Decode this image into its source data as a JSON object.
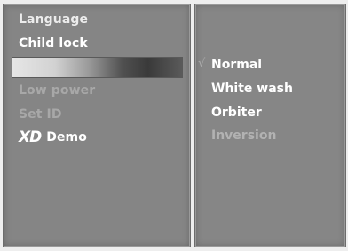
{
  "main_menu": {
    "items": [
      {
        "label": "Language"
      },
      {
        "label": "Child lock"
      },
      {
        "label": ""
      },
      {
        "label": "Low power"
      },
      {
        "label": "Set ID"
      },
      {
        "logo": "XD",
        "label": "Demo"
      }
    ],
    "selected_index": 2
  },
  "submenu": {
    "check_mark": "√",
    "items": [
      {
        "label": "Normal",
        "checked": true
      },
      {
        "label": "White wash"
      },
      {
        "label": "Orbiter"
      },
      {
        "label": "Inversion"
      }
    ]
  },
  "colors": {
    "panel": "#858585",
    "text_active": "#ffffff",
    "text_disabled": "#a8a8a8"
  }
}
